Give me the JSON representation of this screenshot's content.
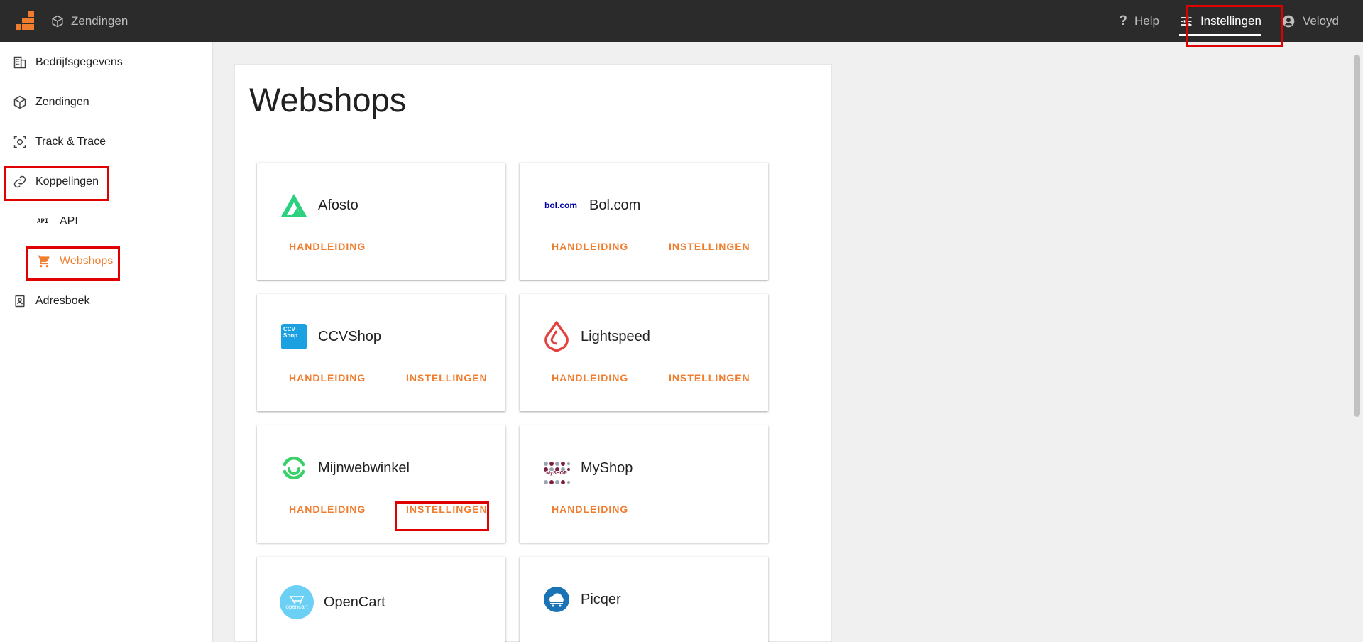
{
  "topbar": {
    "app_label": "Zendingen",
    "help_label": "Help",
    "settings_label": "Instellingen",
    "user_label": "Veloyd"
  },
  "sidebar": {
    "items": [
      {
        "label": "Bedrijfsgegevens",
        "icon": "building-icon"
      },
      {
        "label": "Zendingen",
        "icon": "package-icon"
      },
      {
        "label": "Track & Trace",
        "icon": "track-trace-icon"
      },
      {
        "label": "Koppelingen",
        "icon": "link-icon"
      },
      {
        "label": "API",
        "icon": "api-icon"
      },
      {
        "label": "Webshops",
        "icon": "cart-icon"
      },
      {
        "label": "Adresboek",
        "icon": "address-book-icon"
      }
    ],
    "active": "Webshops"
  },
  "main": {
    "title": "Webshops",
    "cards": [
      {
        "name": "Afosto",
        "buttons": [
          "HANDLEIDING"
        ]
      },
      {
        "name": "Bol.com",
        "logo_text": "bol.com",
        "buttons": [
          "HANDLEIDING",
          "INSTELLINGEN"
        ]
      },
      {
        "name": "CCVShop",
        "logo_text": "CCV Shop",
        "buttons": [
          "HANDLEIDING",
          "INSTELLINGEN"
        ]
      },
      {
        "name": "Lightspeed",
        "buttons": [
          "HANDLEIDING",
          "INSTELLINGEN"
        ]
      },
      {
        "name": "Mijnwebwinkel",
        "buttons": [
          "HANDLEIDING",
          "INSTELLINGEN"
        ]
      },
      {
        "name": "MyShop",
        "logo_text": "MySHOP",
        "buttons": [
          "HANDLEIDING"
        ]
      },
      {
        "name": "OpenCart",
        "logo_text": "opencart",
        "buttons": []
      },
      {
        "name": "Picqer",
        "buttons": []
      }
    ]
  },
  "colors": {
    "accent": "#f07d2e",
    "topbar": "#2b2b2b",
    "highlight": "#e00000"
  }
}
